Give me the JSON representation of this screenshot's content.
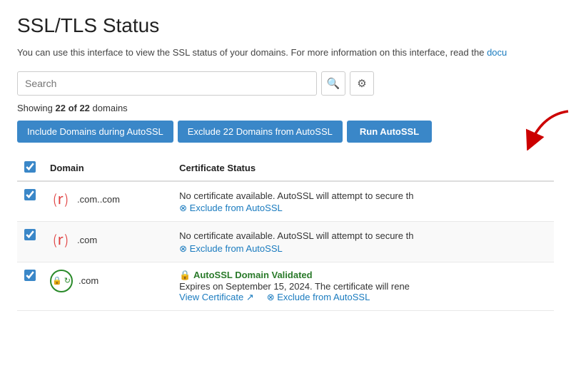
{
  "page": {
    "title": "SSL/TLS Status",
    "description_start": "You can use this interface to view the SSL status of your domains. For more information on this interface, read the ",
    "description_link_text": "docu",
    "search_placeholder": "Search",
    "showing_label": "Showing",
    "showing_count": "22 of 22",
    "showing_suffix": "domains"
  },
  "toolbar": {
    "include_label": "Include Domains during AutoSSL",
    "exclude_label": "Exclude 22 Domains from AutoSSL",
    "run_label": "Run AutoSSL",
    "search_icon": "🔍",
    "gear_icon": "⚙"
  },
  "table": {
    "col_domain": "Domain",
    "col_cert_status": "Certificate Status",
    "rows": [
      {
        "checked": true,
        "icon_type": "blocked",
        "domain_prefix": ".com.",
        "domain_suffix": ".com",
        "cert_text": "No certificate available. AutoSSL will attempt to secure th",
        "exclude_text": "Exclude from AutoSSL"
      },
      {
        "checked": true,
        "icon_type": "blocked",
        "domain_prefix": "",
        "domain_suffix": ".com",
        "cert_text": "No certificate available. AutoSSL will attempt to secure th",
        "exclude_text": "Exclude from AutoSSL"
      },
      {
        "checked": true,
        "icon_type": "locked",
        "domain_prefix": "",
        "domain_suffix": ".com",
        "cert_status_label": "AutoSSL Domain Validated",
        "cert_expires": "Expires on September 15, 2024. The certificate will rene",
        "view_cert_text": "View Certificate",
        "exclude_text": "Exclude from AutoSSL"
      }
    ]
  }
}
